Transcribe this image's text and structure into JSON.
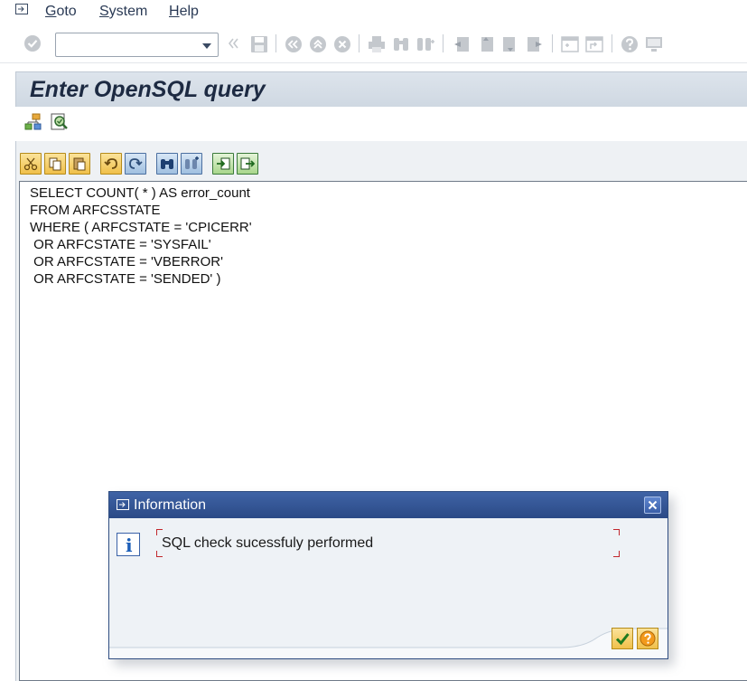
{
  "menu": {
    "items": [
      {
        "label_ul": "G",
        "label_rest": "oto"
      },
      {
        "label_ul": "S",
        "label_rest": "ystem"
      },
      {
        "label_ul": "H",
        "label_rest": "elp"
      }
    ]
  },
  "toolbar": {
    "command_field_value": ""
  },
  "screen": {
    "title": "Enter OpenSQL query"
  },
  "editor": {
    "lines": [
      "SELECT COUNT( * ) AS error_count",
      "FROM ARFCSSTATE",
      "WHERE ( ARFCSTATE = 'CPICERR'",
      " OR ARFCSTATE = 'SYSFAIL'",
      " OR ARFCSTATE = 'VBERROR'",
      " OR ARFCSTATE = 'SENDED' )"
    ]
  },
  "dialog": {
    "title": "Information",
    "message": "SQL check sucessfuly performed"
  },
  "colors": {
    "dialog_title_bg": "#2b4a86",
    "accent_yellow": "#f0c04a",
    "info_blue": "#1d5fb8",
    "focus_red": "#c2272d"
  }
}
